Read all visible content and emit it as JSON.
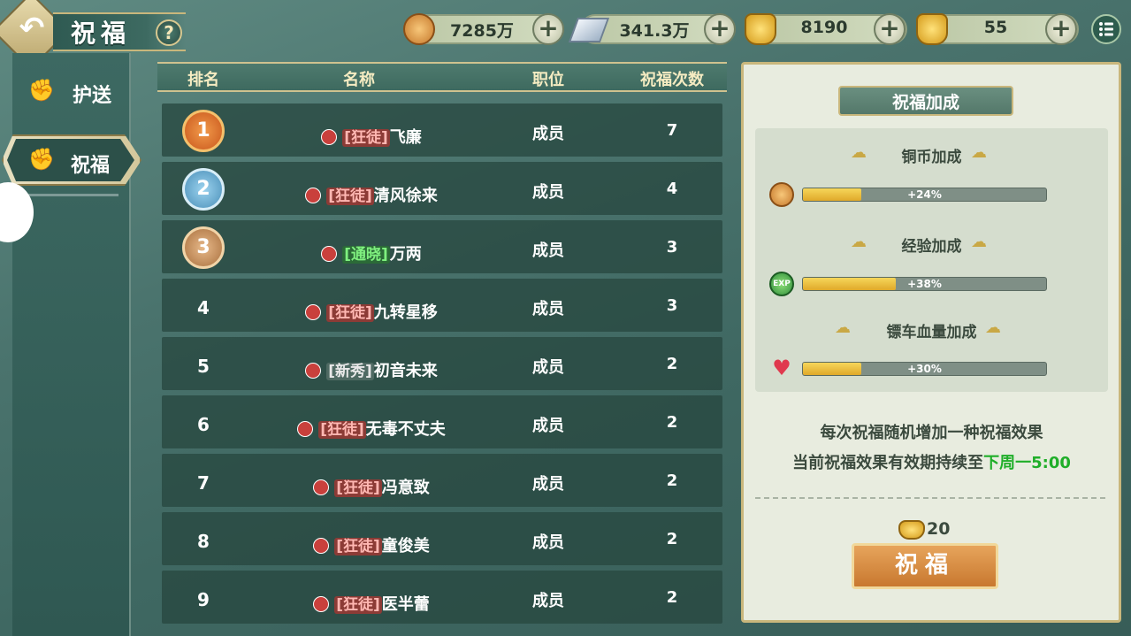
{
  "header": {
    "title": "祝福",
    "help_icon": "question-icon",
    "resources": [
      {
        "name": "copper-coin",
        "value": "7285万",
        "icon": "coin-icon"
      },
      {
        "name": "silver",
        "value": "341.3万",
        "icon": "silver-ingot-icon"
      },
      {
        "name": "gold-ingot-bag",
        "value": "8190",
        "icon": "gold-ingot-icon"
      },
      {
        "name": "gold-ingot",
        "value": "55",
        "icon": "gold-ingot-icon"
      }
    ]
  },
  "sidebar": {
    "items": [
      {
        "label": "护送",
        "icon": "fist-icon",
        "active": false
      },
      {
        "label": "祝福",
        "icon": "fist-icon",
        "active": true
      }
    ]
  },
  "table": {
    "headers": [
      "排名",
      "名称",
      "职位",
      "祝福次数"
    ],
    "rows": [
      {
        "rank": "1",
        "tag": "[狂徒]",
        "name": "飞廉",
        "position": "成员",
        "count": "7"
      },
      {
        "rank": "2",
        "tag": "[狂徒]",
        "name": "清风徐来",
        "position": "成员",
        "count": "4"
      },
      {
        "rank": "3",
        "tag": "[通晓]",
        "name": "万两",
        "position": "成员",
        "count": "3"
      },
      {
        "rank": "4",
        "tag": "[狂徒]",
        "name": "九转星移",
        "position": "成员",
        "count": "3"
      },
      {
        "rank": "5",
        "tag": "[新秀]",
        "name": "初音未来",
        "position": "成员",
        "count": "2"
      },
      {
        "rank": "6",
        "tag": "[狂徒]",
        "name": "无毒不丈夫",
        "position": "成员",
        "count": "2"
      },
      {
        "rank": "7",
        "tag": "[狂徒]",
        "name": "冯意致",
        "position": "成员",
        "count": "2"
      },
      {
        "rank": "8",
        "tag": "[狂徒]",
        "name": "童俊美",
        "position": "成员",
        "count": "2"
      },
      {
        "rank": "9",
        "tag": "[狂徒]",
        "name": "医半蕾",
        "position": "成员",
        "count": "2"
      }
    ]
  },
  "panel": {
    "title": "祝福加成",
    "bonuses": [
      {
        "title": "铜币加成",
        "value": "+24%",
        "fraction": 0.24,
        "icon": "coin-icon"
      },
      {
        "title": "经验加成",
        "value": "+38%",
        "fraction": 0.38,
        "icon": "exp-icon"
      },
      {
        "title": "镖车血量加成",
        "value": "+30%",
        "fraction": 0.24,
        "icon": "heart-icon"
      }
    ],
    "note1": "每次祝福随机增加一种祝福效果",
    "note2_prefix": "当前祝福效果有效期持续至",
    "note2_highlight": "下周一5:00",
    "cost": "20",
    "button_label": "祝福"
  },
  "colors": {
    "highlight_green": "#1fae29",
    "tag_red": "#c9403c",
    "tag_green": "#2e9a3a"
  }
}
